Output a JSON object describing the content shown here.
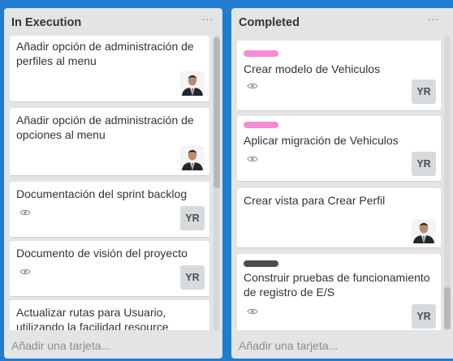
{
  "lists": [
    {
      "title": "In Execution",
      "menu": "···",
      "add_card": "Añadir una tarjeta...",
      "cards": [
        {
          "title": "Añadir opción de administración de perfiles al menu",
          "member": "photo"
        },
        {
          "title": "Añadir opción de administración de opciones al menu",
          "member": "photo"
        },
        {
          "title": "Documentación del sprint backlog",
          "watch": "eye-icon",
          "member": "YR"
        },
        {
          "title": "Documento de visión del proyecto",
          "watch": "eye-icon",
          "member": "YR"
        },
        {
          "title": "Actualizar rutas para Usuario, utilizando la facilidad resource"
        }
      ]
    },
    {
      "title": "Completed",
      "menu": "···",
      "add_card": "Añadir una tarjeta...",
      "cards": [
        {
          "label_color": "#f58cd4",
          "title": "Crear modelo de Vehiculos",
          "watch": "eye-icon",
          "member": "YR"
        },
        {
          "label_color": "#f58cd4",
          "title": "Aplicar migración de Vehiculos",
          "watch": "eye-icon",
          "member": "YR"
        },
        {
          "title": "Crear vista para Crear Perfil",
          "member": "photo"
        },
        {
          "label_color": "#4d4d4d",
          "title": "Construir pruebas de funcionamiento de registro de E/S",
          "watch": "eye-icon",
          "member": "YR"
        }
      ]
    }
  ],
  "colors": {
    "board_bg": "#1f7ccf",
    "list_bg": "#e2e4e6",
    "card_bg": "#ffffff",
    "label_pink": "#f58cd4",
    "label_dark": "#4d4d4d"
  }
}
